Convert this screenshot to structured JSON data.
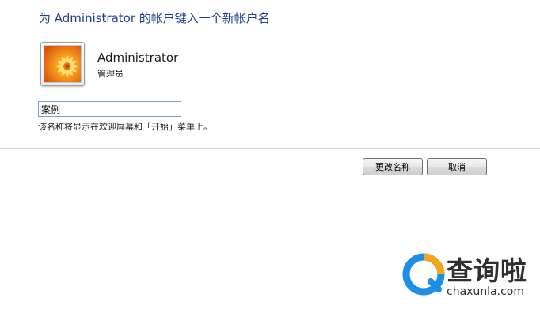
{
  "dialog": {
    "title": "为 Administrator 的帐户键入一个新帐户名",
    "user": {
      "name": "Administrator",
      "role": "管理员"
    },
    "new_name_input": {
      "value": "案例"
    },
    "hint": "该名称将显示在欢迎屏幕和「开始」菜单上。",
    "buttons": {
      "rename": "更改名称",
      "cancel": "取消"
    }
  },
  "watermark": {
    "brand": "查询啦",
    "url": "chaxunla.com"
  },
  "colors": {
    "title": "#1e3f8e",
    "input_border": "#7a9cc9",
    "logo_blue": "#1e8fe6",
    "logo_orange": "#f7a21b"
  }
}
